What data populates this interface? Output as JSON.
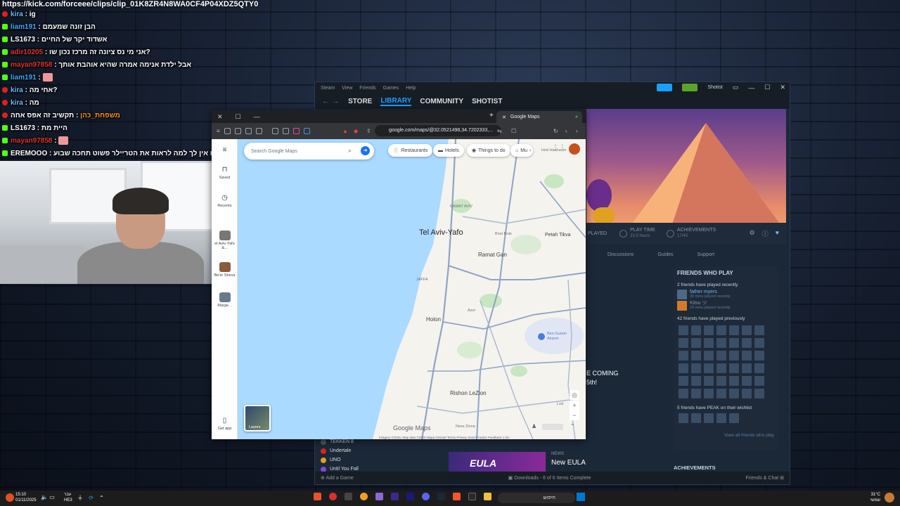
{
  "chat": {
    "url": "https://kick.com/forceee/clips/clip_01K8ZR4N8WA0CF4P04XDZ5QTY0",
    "messages": [
      {
        "user": "kira",
        "text": "ig",
        "user_color": "#6cb8f0",
        "badge": "red"
      },
      {
        "user": "liam191",
        "text": "הבן זונה שמעמם",
        "user_color": "#3fa9f5",
        "badge": "kick"
      },
      {
        "user": "LS1673",
        "text": "אשדוד יקר של החיים",
        "user_color": "#ffffff",
        "badge": "kick"
      },
      {
        "user": "adir10205",
        "text": "אני מי נס ציונה זה מרכז נכון שו?",
        "user_color": "#e0302a",
        "badge": "kick"
      },
      {
        "user": "mayan97858",
        "text": "אבל ילדת אנימה אמרה שהיא אוהבת אותך",
        "user_color": "#e0302a",
        "badge": "kick"
      },
      {
        "user": "liam191",
        "text": "",
        "user_color": "#3fa9f5",
        "badge": "kick",
        "emote": true
      },
      {
        "user": "kira",
        "text": "אחי מה?",
        "user_color": "#6cb8f0",
        "badge": "red"
      },
      {
        "user": "kira",
        "text": "מה",
        "user_color": "#6cb8f0",
        "badge": "red"
      },
      {
        "user": "משפחת_כהן",
        "text": "תקשיב זה אפס אחה",
        "user_color": "#ff8c1a",
        "badge": "red"
      },
      {
        "user": "LS1673",
        "text": "היית מת",
        "user_color": "#ffffff",
        "badge": "kick"
      },
      {
        "user": "mayan97858",
        "text": "",
        "user_color": "#e0302a",
        "badge": "kick",
        "emote": true
      },
      {
        "user": "EREMOOO",
        "text": "שו אין לך למה לראות את הטריילר פשוט תחכה שבוע",
        "user_color": "#ffffff",
        "badge": "kick"
      }
    ]
  },
  "steam": {
    "top_menu": [
      "Steam",
      "View",
      "Friends",
      "Games",
      "Help"
    ],
    "nav": {
      "store": "STORE",
      "library": "LIBRARY",
      "community": "COMMUNITY",
      "user": "SHOTIST"
    },
    "account_name": "Shotist",
    "stats": {
      "played_label": "PLAYED",
      "playtime_label": "PLAY TIME",
      "playtime_value": "23.5 hours",
      "achievements_label": "ACHIEVEMENTS",
      "achievements_value": "17/43"
    },
    "subtabs": [
      "Discussions",
      "Guides",
      "Support"
    ],
    "friends": {
      "title": "FRIENDS WHO PLAY",
      "recent_header": "2 friends have played recently",
      "recent": [
        {
          "name": "father myers",
          "sub": "39 mins played recently"
        },
        {
          "name": "Kitsu ツ",
          "sub": "29 mins played recently"
        }
      ],
      "previous_header": "42 friends have played previously",
      "wishlist_header": "5 friends have PEAK on their wishlist",
      "view_all": "View all friends who play"
    },
    "achievements_section": "ACHIEVEMENTS",
    "coming": [
      "E COMING",
      "5th!"
    ],
    "news": {
      "label": "NEWS",
      "headline": "New EULA",
      "thumb_text": "EULA"
    },
    "games": [
      {
        "name": "TEKKEN 8",
        "color": "#555"
      },
      {
        "name": "Undertale",
        "color": "#e02020"
      },
      {
        "name": "UNO",
        "color": "#e0a020"
      },
      {
        "name": "Until You Fall",
        "color": "#7a4ad0"
      }
    ],
    "bottom": {
      "add_game": "Add a Game",
      "downloads": "Downloads - 6 of 6 Items Complete",
      "friends_chat": "Friends & Chat"
    }
  },
  "browser": {
    "tab_title": "Google Maps",
    "address": "google.com/maps/@32.0521498,34.7202333,...",
    "search_placeholder": "Search Google Maps",
    "chips": [
      "Restaurants",
      "Hotels",
      "Things to do",
      "Mu"
    ],
    "side": {
      "saved": "Saved",
      "recents": "Recents",
      "item1": "el Aviv-Yafo &...",
      "item2": "Be'er Sheva",
      "item3": "Marge...",
      "get_app": "Get app"
    },
    "layers": "Layers",
    "brand": "Google Maps",
    "footer": "Imagery ©2025, Map data ©2025 Mapa GISrael   Terms   Privacy   Send Product Feedback   1 km",
    "places": {
      "tel_aviv": "Tel Aviv-Yafo",
      "ramat_gan": "Ramat Gan",
      "petah_tikva": "Petah Tikva",
      "holon": "Holon",
      "rishon": "Rishon LeZion",
      "airport": "Ben Gurion Airport",
      "ramat_aviv": "RAMAT AVIV",
      "bnei_brak": "Bnei Brak",
      "jaffa": "JAFFA",
      "azor": "Azor",
      "hod_hasharon": "Hod Hasharon",
      "ness_ziona": "Ness Ziona",
      "lod": "Lod"
    }
  },
  "taskbar": {
    "time": "15:10",
    "date": "01/11/2025",
    "lang": "עבר",
    "lang2": "HE3",
    "search": "חיפוש",
    "weather_temp": "31°C",
    "weather_desc": "שמשי"
  }
}
